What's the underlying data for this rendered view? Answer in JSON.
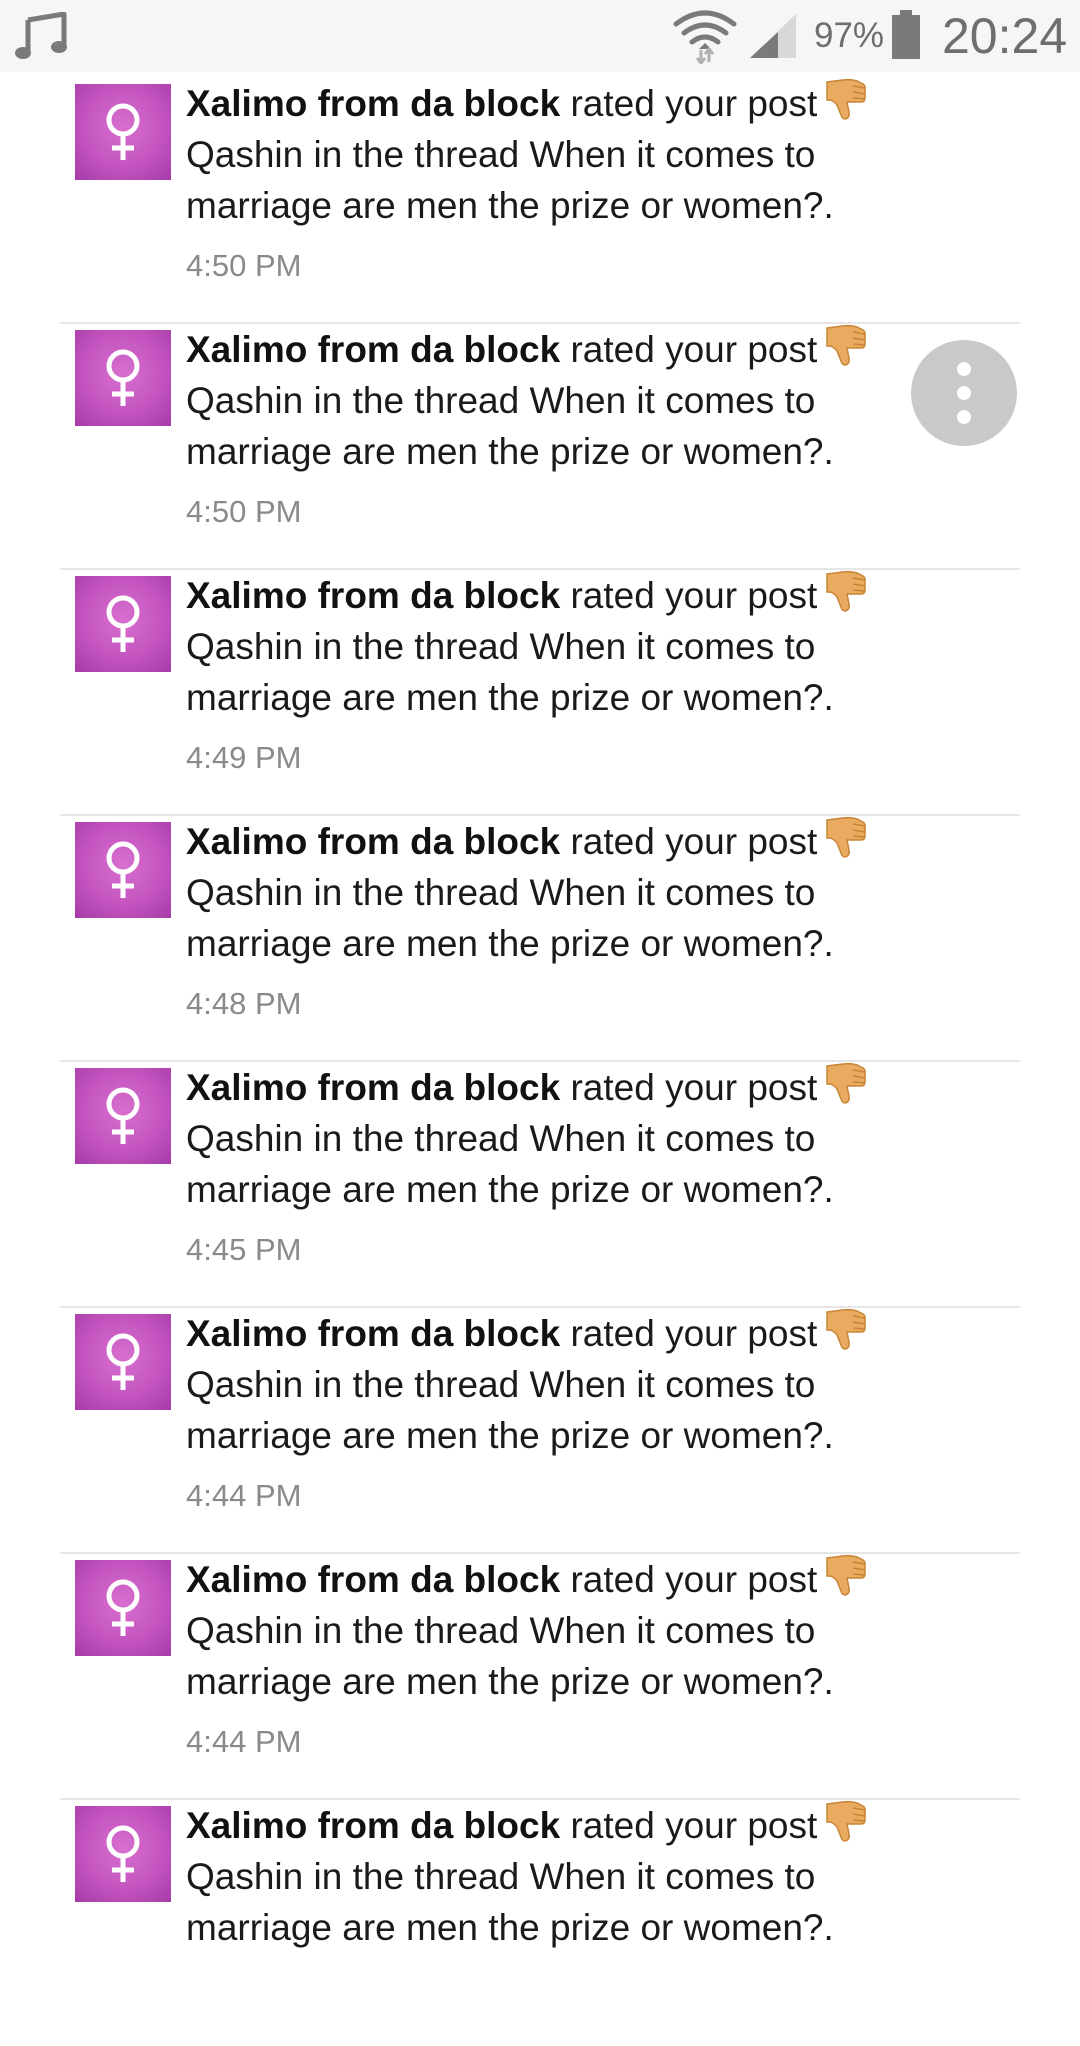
{
  "status_bar": {
    "left_icon": "music-note-icon",
    "wifi_icon": "wifi-icon",
    "signal_icon": "cell-signal-icon",
    "battery_percent": "97%",
    "battery_icon": "battery-icon",
    "clock": "20:24"
  },
  "colors": {
    "avatar": "#c455c0",
    "thumb": "#e8a95c",
    "status_bar_bg": "#f6f6f6"
  },
  "menu_button": {
    "icon": "more-vertical-icon"
  },
  "notifications": [
    {
      "user": "Xalimo from da block",
      "action": "rated your post",
      "rating_icon": "thumbs-down-icon",
      "line2": "Qashin in the thread When it comes to",
      "line3": "marriage are men the prize or women?.",
      "time": "4:50 PM"
    },
    {
      "user": "Xalimo from da block",
      "action": "rated your post",
      "rating_icon": "thumbs-down-icon",
      "line2": "Qashin in the thread When it comes to",
      "line3": "marriage are men the prize or women?.",
      "time": "4:50 PM"
    },
    {
      "user": "Xalimo from da block",
      "action": "rated your post",
      "rating_icon": "thumbs-down-icon",
      "line2": "Qashin in the thread When it comes to",
      "line3": "marriage are men the prize or women?.",
      "time": "4:49 PM"
    },
    {
      "user": "Xalimo from da block",
      "action": "rated your post",
      "rating_icon": "thumbs-down-icon",
      "line2": "Qashin in the thread When it comes to",
      "line3": "marriage are men the prize or women?.",
      "time": "4:48 PM"
    },
    {
      "user": "Xalimo from da block",
      "action": "rated your post",
      "rating_icon": "thumbs-down-icon",
      "line2": "Qashin in the thread When it comes to",
      "line3": "marriage are men the prize or women?.",
      "time": "4:45 PM"
    },
    {
      "user": "Xalimo from da block",
      "action": "rated your post",
      "rating_icon": "thumbs-down-icon",
      "line2": "Qashin in the thread When it comes to",
      "line3": "marriage are men the prize or women?.",
      "time": "4:44 PM"
    },
    {
      "user": "Xalimo from da block",
      "action": "rated your post",
      "rating_icon": "thumbs-down-icon",
      "line2": "Qashin in the thread When it comes to",
      "line3": "marriage are men the prize or women?.",
      "time": "4:44 PM"
    },
    {
      "user": "Xalimo from da block",
      "action": "rated your post",
      "rating_icon": "thumbs-down-icon",
      "line2": "Qashin in the thread When it comes to",
      "line3": "marriage are men the prize or women?.",
      "time": ""
    }
  ]
}
